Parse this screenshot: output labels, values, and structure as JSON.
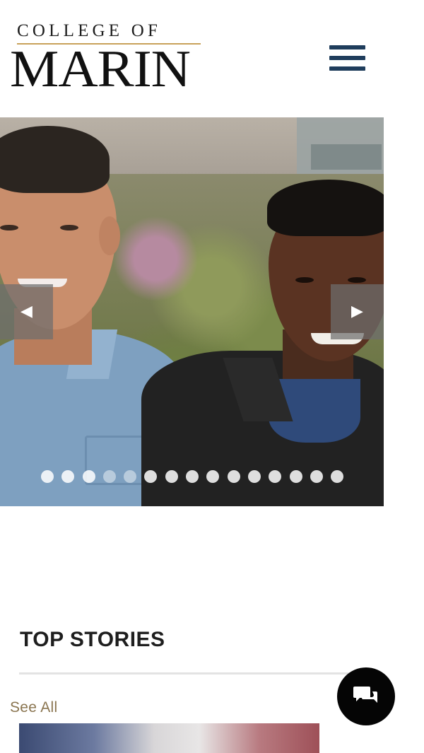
{
  "header": {
    "logo_top": "COLLEGE OF",
    "logo_main": "MARIN",
    "menu_icon": "hamburger-menu-icon",
    "brand_color": "#1f3d5c",
    "rule_color": "#c9a25a"
  },
  "carousel": {
    "prev_glyph": "◀",
    "next_glyph": "▶",
    "slide_count": 15,
    "active_slides": [
      4,
      5
    ]
  },
  "top_stories": {
    "title": "TOP STORIES",
    "see_all": "See All",
    "see_all_color": "#8a7550"
  },
  "chat": {
    "icon": "chat-bubbles-icon"
  }
}
